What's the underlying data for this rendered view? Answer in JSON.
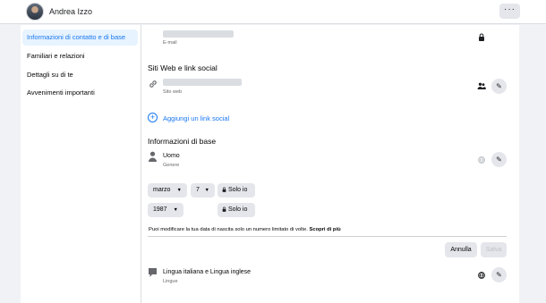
{
  "header": {
    "profile_name": "Andrea Izzo",
    "more_label": "···"
  },
  "sidebar": {
    "items": [
      {
        "label": "Informazioni di contatto e di base",
        "active": true
      },
      {
        "label": "Familiari e relazioni",
        "active": false
      },
      {
        "label": "Dettagli su di te",
        "active": false
      },
      {
        "label": "Avvenimenti importanti",
        "active": false
      }
    ]
  },
  "contact": {
    "email_caption": "E-mail",
    "privacy_icon": "lock-icon"
  },
  "websites": {
    "title": "Siti Web e link social",
    "site_caption": "Sito web",
    "privacy_icon": "friends-icon",
    "add_social_label": "Aggiungi un link social"
  },
  "basic_info": {
    "title": "Informazioni di base",
    "gender_value": "Uomo",
    "gender_caption": "Genere",
    "privacy_icon": "globe-icon",
    "birth_month": "marzo",
    "birth_day": "7",
    "birth_year": "1987",
    "privacy_only_me_1": "Solo io",
    "privacy_only_me_2": "Solo io",
    "birthdate_note": "Puoi modificare la tua data di nascita solo un numero limitato di volte.",
    "learn_more": "Scopri di più",
    "cancel_label": "Annulla",
    "save_label": "Salva",
    "languages_value": "Lingua italiana e Lingua inglese",
    "languages_caption": "Lingue"
  }
}
